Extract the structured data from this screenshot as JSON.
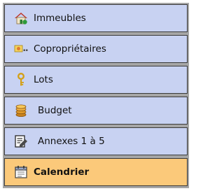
{
  "nav": {
    "items": [
      {
        "label": "Immeubles",
        "icon": "house-icon",
        "active": false
      },
      {
        "label": "Copropriétaires",
        "icon": "owners-card-icon",
        "active": false
      },
      {
        "label": "Lots",
        "icon": "key-icon",
        "active": false
      },
      {
        "label": "Budget",
        "icon": "coins-icon",
        "active": false
      },
      {
        "label": "Annexes 1 à 5",
        "icon": "document-pencil-icon",
        "active": false
      },
      {
        "label": "Calendrier",
        "icon": "calendar-icon",
        "active": true
      }
    ]
  },
  "colors": {
    "item_background": "#c8d2f2",
    "active_background": "#fbc97a",
    "border": "#3a3a3a",
    "frame": "#a6a6a6"
  }
}
